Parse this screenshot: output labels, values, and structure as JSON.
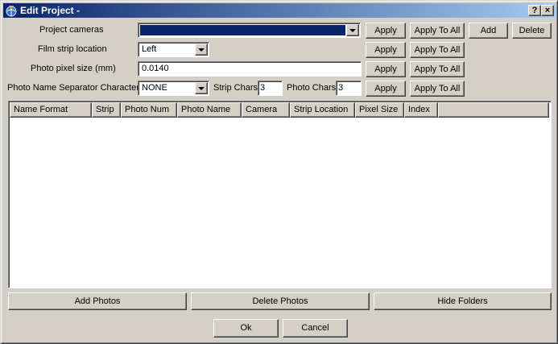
{
  "window": {
    "title": "Edit Project -",
    "help_label": "?",
    "close_label": "×"
  },
  "rows": {
    "cameras": {
      "label": "Project cameras",
      "value": "",
      "apply": "Apply",
      "apply_all": "Apply To All",
      "add": "Add",
      "delete": "Delete"
    },
    "film_strip": {
      "label": "Film strip location",
      "value": "Left",
      "apply": "Apply",
      "apply_all": "Apply To All"
    },
    "pixel_size": {
      "label": "Photo pixel size (mm)",
      "value": "0.0140",
      "apply": "Apply",
      "apply_all": "Apply To All"
    },
    "separator": {
      "label": "Photo Name Separator Character",
      "value": "NONE",
      "strip_chars_label": "Strip Chars",
      "strip_chars_value": "3",
      "photo_chars_label": "Photo Chars",
      "photo_chars_value": "3",
      "apply": "Apply",
      "apply_all": "Apply To All"
    }
  },
  "table": {
    "columns": [
      "Name Format",
      "Strip",
      "Photo Num",
      "Photo Name",
      "Camera",
      "Strip Location",
      "Pixel Size",
      "Index"
    ],
    "rows": []
  },
  "actions": {
    "add_photos": "Add Photos",
    "delete_photos": "Delete Photos",
    "hide_folders": "Hide Folders",
    "ok": "Ok",
    "cancel": "Cancel"
  },
  "colors": {
    "title_start": "#0a246a",
    "title_end": "#a6caf0",
    "face": "#d4d0c8",
    "selection": "#0a246a"
  },
  "icons": {
    "title": "app-globe-icon",
    "dropdown": "chevron-down-icon"
  }
}
